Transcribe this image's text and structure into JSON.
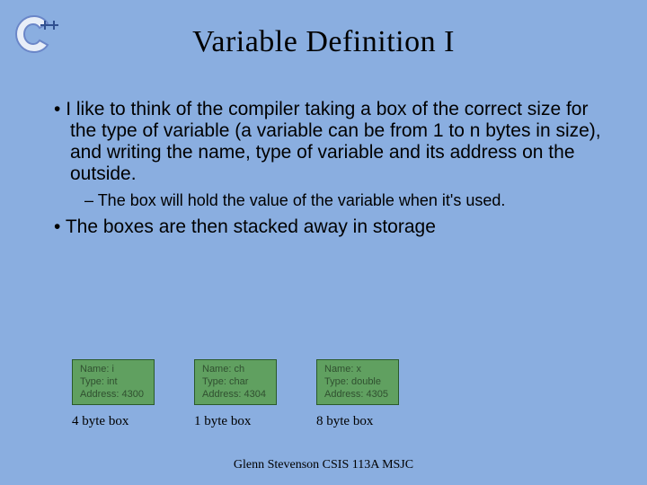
{
  "title": "Variable Definition I",
  "bullets": {
    "b1": "I like to think of the compiler taking a box of the correct size for the type of variable (a variable can be from 1 to n bytes in size), and writing the name, type of variable and its address on the outside.",
    "b1_sub1": "The box will hold the value of the variable when it's used.",
    "b2": "The boxes are then stacked away in storage"
  },
  "boxes": [
    {
      "name": "Name: i",
      "type": "Type: int",
      "addr": "Address: 4300",
      "caption": "4 byte box"
    },
    {
      "name": "Name: ch",
      "type": "Type: char",
      "addr": "Address: 4304",
      "caption": "1 byte box"
    },
    {
      "name": "Name: x",
      "type": "Type: double",
      "addr": "Address: 4305",
      "caption": "8 byte box"
    }
  ],
  "footer": "Glenn Stevenson CSIS 113A MSJC"
}
